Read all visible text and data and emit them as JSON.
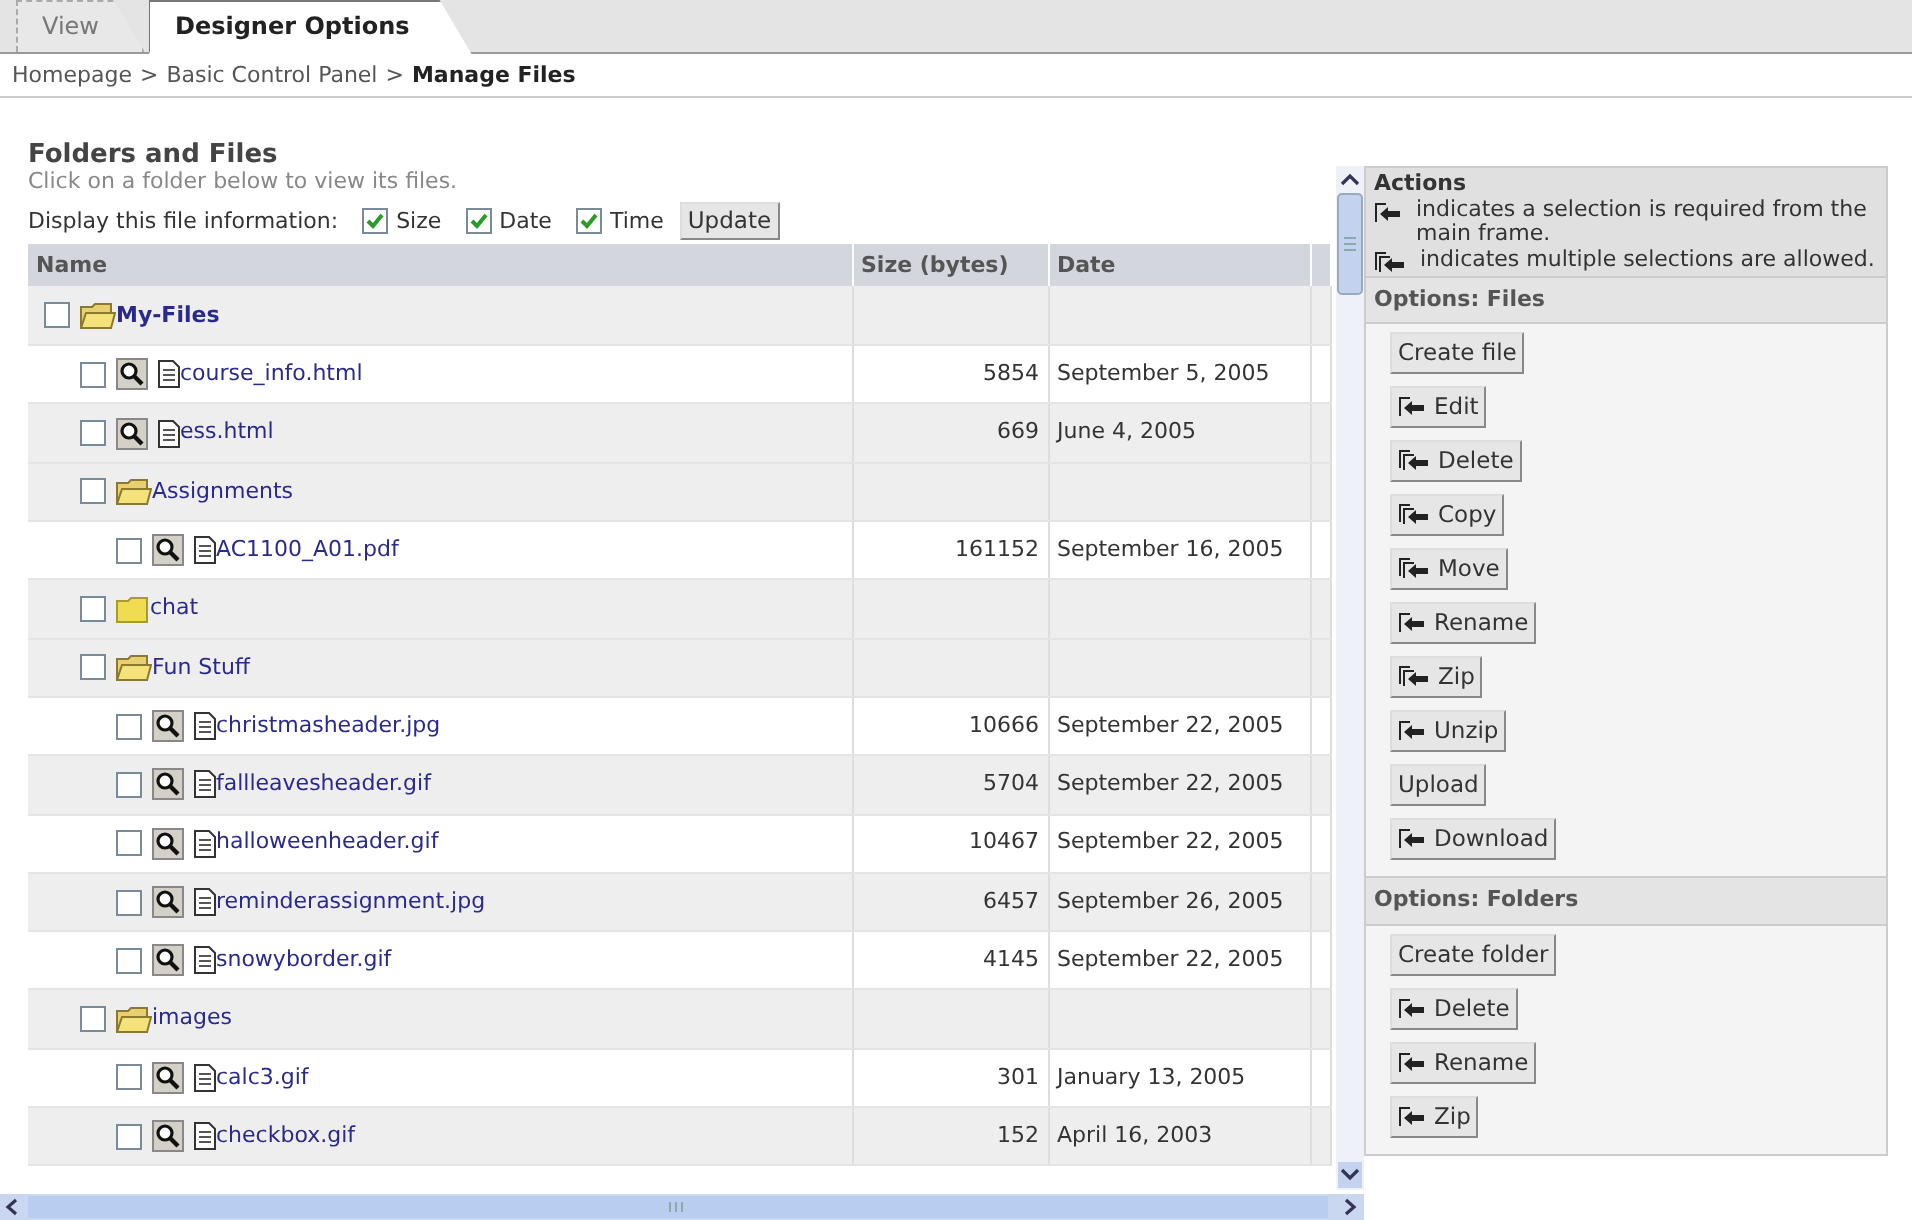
{
  "tabs": [
    {
      "label": "View",
      "selected": false
    },
    {
      "label": "Designer Options",
      "selected": true
    }
  ],
  "breadcrumb": [
    {
      "label": "Homepage",
      "current": false
    },
    {
      "label": "Basic Control Panel",
      "current": false
    },
    {
      "label": "Manage Files",
      "current": true
    }
  ],
  "breadcrumb_separator": ">",
  "files_panel": {
    "title": "Folders and Files",
    "subtitle": "Click on a folder below to view its files.",
    "display_label": "Display this file information:",
    "display_options": [
      {
        "label": "Size",
        "checked": true
      },
      {
        "label": "Date",
        "checked": true
      },
      {
        "label": "Time",
        "checked": true
      }
    ],
    "update_button": "Update",
    "columns": [
      "Name",
      "Size (bytes)",
      "Date"
    ],
    "tree": [
      {
        "kind": "folder",
        "name": "My-Files",
        "expanded": true,
        "checked": false,
        "children": [
          {
            "kind": "file",
            "name": "course_info.html",
            "size": "5854",
            "date": "September 5, 2005",
            "checked": false
          },
          {
            "kind": "file",
            "name": "ess.html",
            "size": "669",
            "date": "June 4, 2005",
            "checked": false
          },
          {
            "kind": "folder",
            "name": "Assignments",
            "expanded": true,
            "checked": false,
            "children": [
              {
                "kind": "file",
                "name": "AC1100_A01.pdf",
                "size": "161152",
                "date": "September 16, 2005",
                "checked": false
              }
            ]
          },
          {
            "kind": "folder",
            "name": "chat",
            "expanded": false,
            "checked": false
          },
          {
            "kind": "folder",
            "name": "Fun Stuff",
            "expanded": true,
            "checked": false,
            "children": [
              {
                "kind": "file",
                "name": "christmasheader.jpg",
                "size": "10666",
                "date": "September 22, 2005",
                "checked": false
              },
              {
                "kind": "file",
                "name": "fallleavesheader.gif",
                "size": "5704",
                "date": "September 22, 2005",
                "checked": false
              },
              {
                "kind": "file",
                "name": "halloweenheader.gif",
                "size": "10467",
                "date": "September 22, 2005",
                "checked": false
              },
              {
                "kind": "file",
                "name": "reminderassignment.jpg",
                "size": "6457",
                "date": "September 26, 2005",
                "checked": false
              },
              {
                "kind": "file",
                "name": "snowyborder.gif",
                "size": "4145",
                "date": "September 22, 2005",
                "checked": false
              }
            ]
          },
          {
            "kind": "folder",
            "name": "images",
            "expanded": true,
            "checked": false,
            "children": [
              {
                "kind": "file",
                "name": "calc3.gif",
                "size": "301",
                "date": "January 13, 2005",
                "checked": false
              },
              {
                "kind": "file",
                "name": "checkbox.gif",
                "size": "152",
                "date": "April 16, 2003",
                "checked": false
              }
            ]
          }
        ]
      }
    ]
  },
  "actions_panel": {
    "title": "Actions",
    "legend": [
      {
        "kind": "single",
        "text": "indicates a selection is required from the main frame."
      },
      {
        "kind": "multiple",
        "text": "indicates multiple selections are allowed."
      }
    ],
    "sections": [
      {
        "title": "Options: Files",
        "buttons": [
          {
            "label": "Create file",
            "kind": "plain"
          },
          {
            "label": "Edit",
            "kind": "single"
          },
          {
            "label": "Delete",
            "kind": "multiple"
          },
          {
            "label": "Copy",
            "kind": "multiple"
          },
          {
            "label": "Move",
            "kind": "multiple"
          },
          {
            "label": "Rename",
            "kind": "single"
          },
          {
            "label": "Zip",
            "kind": "multiple"
          },
          {
            "label": "Unzip",
            "kind": "single"
          },
          {
            "label": "Upload",
            "kind": "plain"
          },
          {
            "label": "Download",
            "kind": "single"
          }
        ]
      },
      {
        "title": "Options: Folders",
        "buttons": [
          {
            "label": "Create folder",
            "kind": "plain"
          },
          {
            "label": "Delete",
            "kind": "single"
          },
          {
            "label": "Rename",
            "kind": "single"
          },
          {
            "label": "Zip",
            "kind": "single"
          }
        ]
      }
    ]
  }
}
